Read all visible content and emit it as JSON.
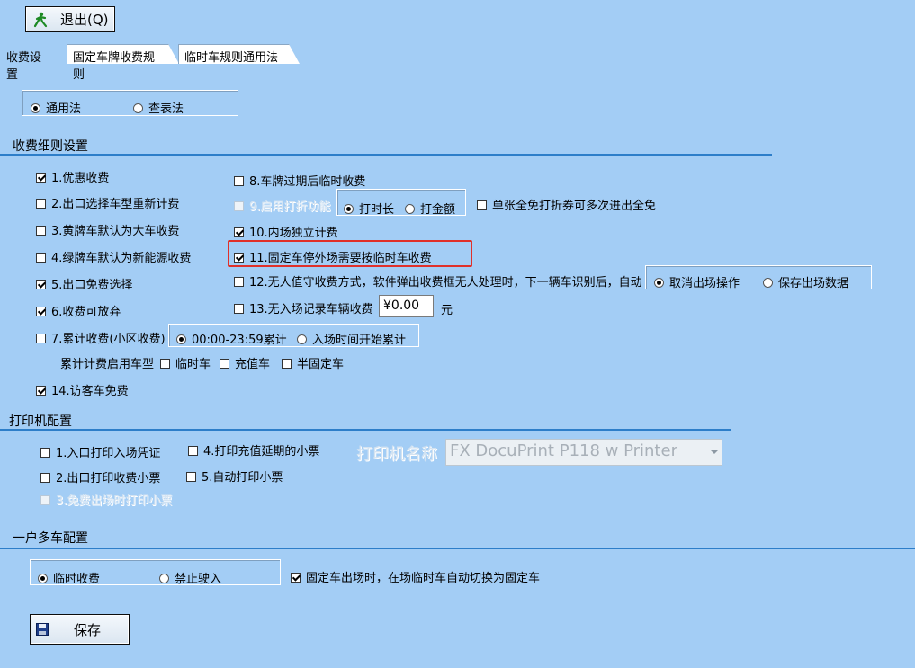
{
  "toolbar": {
    "exit_label": "退出(Q)"
  },
  "tabs": [
    "收费设置",
    "固定车牌收费规则",
    "临时车规则通用法"
  ],
  "method": {
    "option1": "通用法",
    "option2": "查表法"
  },
  "fee_rules": {
    "title": "收费细则设置",
    "r1": "1.优惠收费",
    "r2": "2.出口选择车型重新计费",
    "r3": "3.黄牌车默认为大车收费",
    "r4": "4.绿牌车默认为新能源收费",
    "r5": "5.出口免费选择",
    "r6": "6.收费可放弃",
    "r7": "7.累计收费(小区收费)",
    "r7_opt1": "00:00-23:59累计",
    "r7_opt2": "入场时间开始累计",
    "accum_label": "累计计费启用车型",
    "accum_temp": "临时车",
    "accum_recharge": "充值车",
    "accum_semi": "半固定车",
    "r14": "14.访客车免费",
    "r8": "8.车牌过期后临时收费",
    "r9": "9.启用打折功能",
    "r9_opt1": "打时长",
    "r9_opt2": "打金额",
    "r9_extra": "单张全免打折券可多次进出全免",
    "r10": "10.内场独立计费",
    "r11": "11.固定车停外场需要按临时车收费",
    "r12": "12.无人值守收费方式，软件弹出收费框无人处理时，下一辆车识别后，自动",
    "r12_opt1": "取消出场操作",
    "r12_opt2": "保存出场数据",
    "r13": "13.无入场记录车辆收费",
    "r13_value": "¥0.00",
    "r13_unit": "元"
  },
  "printer": {
    "title": "打印机配置",
    "p1": "1.入口打印入场凭证",
    "p2": "2.出口打印收费小票",
    "p3": "3.免费出场时打印小票",
    "p4": "4.打印充值延期的小票",
    "p5": "5.自动打印小票",
    "name_label": "打印机名称",
    "name_value": "FX DocuPrint P118 w Printer"
  },
  "multi_car": {
    "title": "一户多车配置",
    "opt1": "临时收费",
    "opt2": "禁止驶入",
    "auto_switch": "固定车出场时，在场临时车自动切换为固定车"
  },
  "save_label": "保存",
  "colors": {
    "background": "#a3cdf5",
    "section_line": "#2d7ec9",
    "highlight": "#e0302a"
  }
}
